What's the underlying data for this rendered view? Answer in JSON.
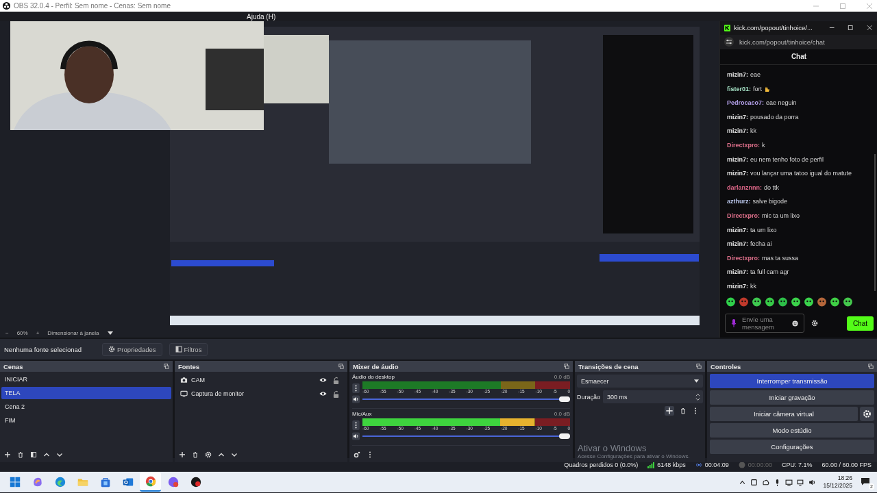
{
  "window": {
    "title": "OBS 32.0.4 - Perfil: Sem nome - Cenas: Sem nome"
  },
  "menu": [
    "Ajuda (H)"
  ],
  "preview": {
    "kind": "picture"
  },
  "zoom_bar": {
    "zoom_out": "−",
    "zoom": "60%",
    "zoom_in": "+",
    "fit": "Dimensionar à janela"
  },
  "chat_window": {
    "title": "kick.com/popout/tinhoice/...",
    "url": "kick.com/popout/tinhoice/chat",
    "header": "Chat",
    "messages": [
      {
        "user": "mizin7:",
        "color": "#e4e4e4",
        "text": "eae",
        "emote": false
      },
      {
        "user": "fister01:",
        "color": "#a6e3c6",
        "text": "fort",
        "emote": true
      },
      {
        "user": "Pedrocaco7:",
        "color": "#b8a4ef",
        "text": "eae neguin",
        "emote": false
      },
      {
        "user": "mizin7:",
        "color": "#e4e4e4",
        "text": "pousado da porra",
        "emote": false
      },
      {
        "user": "mizin7:",
        "color": "#e4e4e4",
        "text": "kk",
        "emote": false
      },
      {
        "user": "Directxpro:",
        "color": "#e0718c",
        "text": "k",
        "emote": false
      },
      {
        "user": "mizin7:",
        "color": "#e4e4e4",
        "text": "eu nem tenho foto de perfil",
        "emote": false
      },
      {
        "user": "mizin7:",
        "color": "#e4e4e4",
        "text": "vou lançar uma tatoo igual do matute",
        "emote": false
      },
      {
        "user": "darlanznnn:",
        "color": "#e0688a",
        "text": "do ttk",
        "emote": false
      },
      {
        "user": "azthurz:",
        "color": "#b7c3e8",
        "text": "salve bigode",
        "emote": false
      },
      {
        "user": "Directxpro:",
        "color": "#e0718c",
        "text": "mic ta um lixo",
        "emote": false
      },
      {
        "user": "mizin7:",
        "color": "#e4e4e4",
        "text": "ta um lixo",
        "emote": false
      },
      {
        "user": "mizin7:",
        "color": "#e4e4e4",
        "text": "fecha ai",
        "emote": false
      },
      {
        "user": "Directxpro:",
        "color": "#e0718c",
        "text": "mas ta sussa",
        "emote": false
      },
      {
        "user": "mizin7:",
        "color": "#e4e4e4",
        "text": "ta full cam agr",
        "emote": false
      },
      {
        "user": "mizin7:",
        "color": "#e4e4e4",
        "text": "kk",
        "emote": false
      }
    ],
    "input": {
      "placeholder": "Envie uma mensagem"
    },
    "send": "Chat"
  },
  "source_toolbar": {
    "label": "Nenhuma fonte selecionad",
    "buttons": [
      {
        "label": "Propriedades",
        "kind": "properties"
      },
      {
        "label": "Filtros",
        "kind": "filters"
      }
    ]
  },
  "scenes": {
    "title": "Cenas",
    "items": [
      {
        "label": "INICIAR",
        "selected": false
      },
      {
        "label": "TELA",
        "selected": true
      },
      {
        "label": "Cena 2",
        "selected": false
      },
      {
        "label": "FIM",
        "selected": false
      }
    ]
  },
  "sources": {
    "title": "Fontes",
    "items": [
      {
        "label": "CAM",
        "kind": "camera",
        "visible": true,
        "locked": false
      },
      {
        "label": "Captura de monitor",
        "kind": "monitor",
        "visible": true,
        "locked": false
      }
    ]
  },
  "mixer": {
    "title": "Mixer de áudio",
    "channels": [
      {
        "name": "Áudio do desktop",
        "reading": "0.0 dB",
        "meter": {
          "level": 0
        },
        "volume": {
          "level": 1
        },
        "ticks": [
          "-60",
          "-55",
          "-50",
          "-45",
          "-40",
          "-35",
          "-30",
          "-25",
          "-20",
          "-15",
          "-10",
          "-5",
          "0"
        ]
      },
      {
        "name": "Mic/Aux",
        "reading": "0.0 dB",
        "meter": {
          "level": 0.83
        },
        "volume": {
          "level": 1
        },
        "ticks": [
          "-60",
          "-55",
          "-50",
          "-45",
          "-40",
          "-35",
          "-30",
          "-25",
          "-20",
          "-15",
          "-10",
          "-5",
          "0"
        ]
      }
    ]
  },
  "transitions": {
    "title": "Transições de cena",
    "transition": "Esmaecer",
    "duration_label": "Duração",
    "duration": "300 ms"
  },
  "controls": {
    "title": "Controles",
    "buttons": [
      {
        "label": "Interromper transmissão",
        "active": true,
        "settings": false
      },
      {
        "label": "Iniciar gravação",
        "active": false,
        "settings": false
      },
      {
        "label": "Iniciar câmera virtual",
        "active": false,
        "settings": true
      },
      {
        "label": "Modo estúdio",
        "active": false,
        "settings": false
      },
      {
        "label": "Configurações",
        "active": false,
        "settings": false
      }
    ]
  },
  "windows_notice": {
    "title": "Ativar o Windows",
    "text": "Acesse Configurações para ativar o Windows."
  },
  "status_bar": [
    {
      "kind": "dropped",
      "text": "Quadros perdidos 0 (0.0%)"
    },
    {
      "kind": "bitrate",
      "text": "6148 kbps"
    },
    {
      "kind": "stream",
      "text": "00:04:09"
    },
    {
      "kind": "record",
      "text": "00:00:00"
    },
    {
      "kind": "cpu",
      "text": "CPU: 7.1%"
    },
    {
      "kind": "fps",
      "text": "60.00 / 60.00 FPS"
    }
  ],
  "taskbar": {
    "apps": [
      {
        "kind": "start",
        "selected": false
      },
      {
        "kind": "copilot",
        "selected": false
      },
      {
        "kind": "edge",
        "selected": false
      },
      {
        "kind": "explorer",
        "selected": false
      },
      {
        "kind": "store",
        "selected": false
      },
      {
        "kind": "outlook",
        "selected": false
      },
      {
        "kind": "chrome",
        "selected": true
      },
      {
        "kind": "messenger",
        "selected": false
      },
      {
        "kind": "obs",
        "selected": false
      }
    ],
    "time": "18:26",
    "date": "15/12/2025",
    "notifications": "2"
  }
}
